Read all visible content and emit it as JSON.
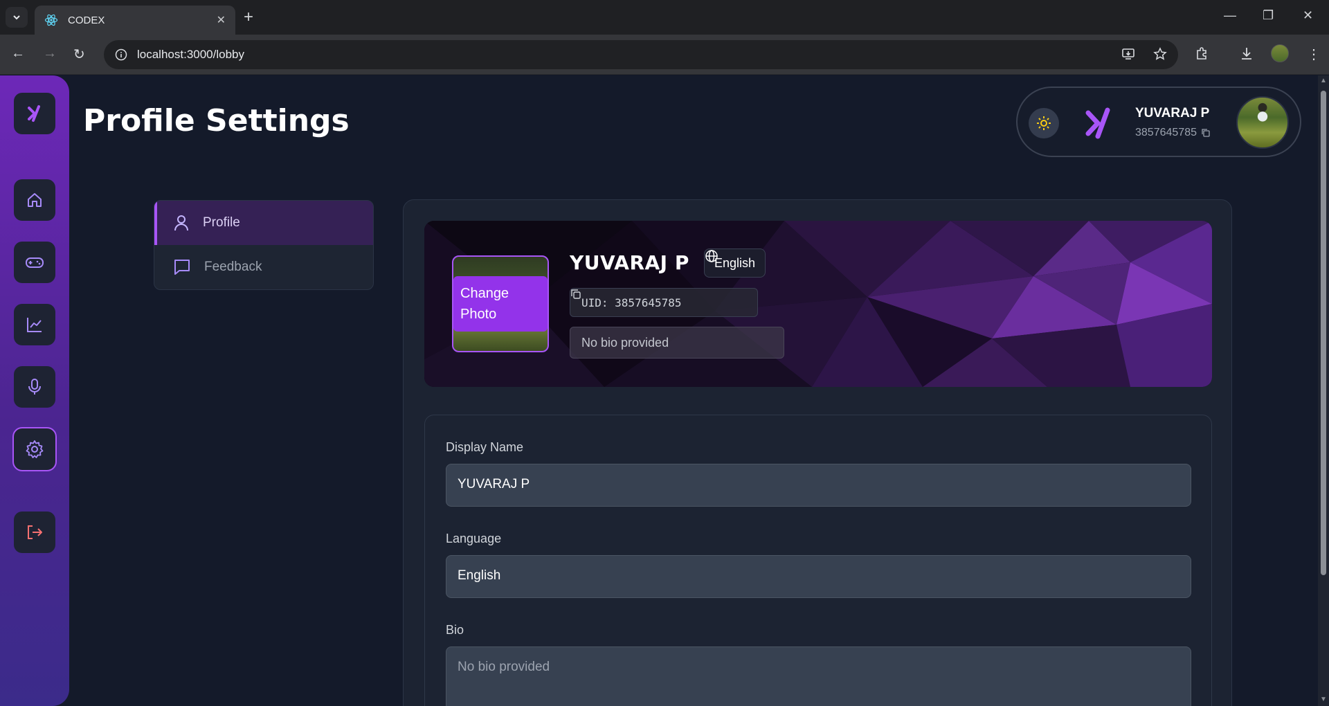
{
  "browser": {
    "tab_title": "CODEX",
    "url": "localhost:3000/lobby"
  },
  "header": {
    "page_title": "Profile Settings",
    "user_name": "YUVARAJ P",
    "user_uid": "3857645785"
  },
  "side_menu": {
    "items": [
      {
        "label": "Profile",
        "icon": "user-icon",
        "active": true
      },
      {
        "label": "Feedback",
        "icon": "message-icon",
        "active": false
      }
    ]
  },
  "rail": {
    "items": [
      "logo-icon",
      "home-icon",
      "gamepad-icon",
      "chart-icon",
      "mic-icon",
      "settings-icon",
      "logout-icon"
    ],
    "active": "settings-icon"
  },
  "banner": {
    "change_photo_label": "Change Photo",
    "name": "YUVARAJ P",
    "language": "English",
    "uid_text": "UID: 3857645785",
    "bio": "No bio provided"
  },
  "form": {
    "display_name_label": "Display Name",
    "display_name_value": "YUVARAJ P",
    "language_label": "Language",
    "language_value": "English",
    "bio_label": "Bio",
    "bio_placeholder": "No bio provided"
  },
  "colors": {
    "accent": "#a855f7",
    "background": "#141a2a",
    "logout": "#f87171",
    "sun": "#facc15"
  }
}
